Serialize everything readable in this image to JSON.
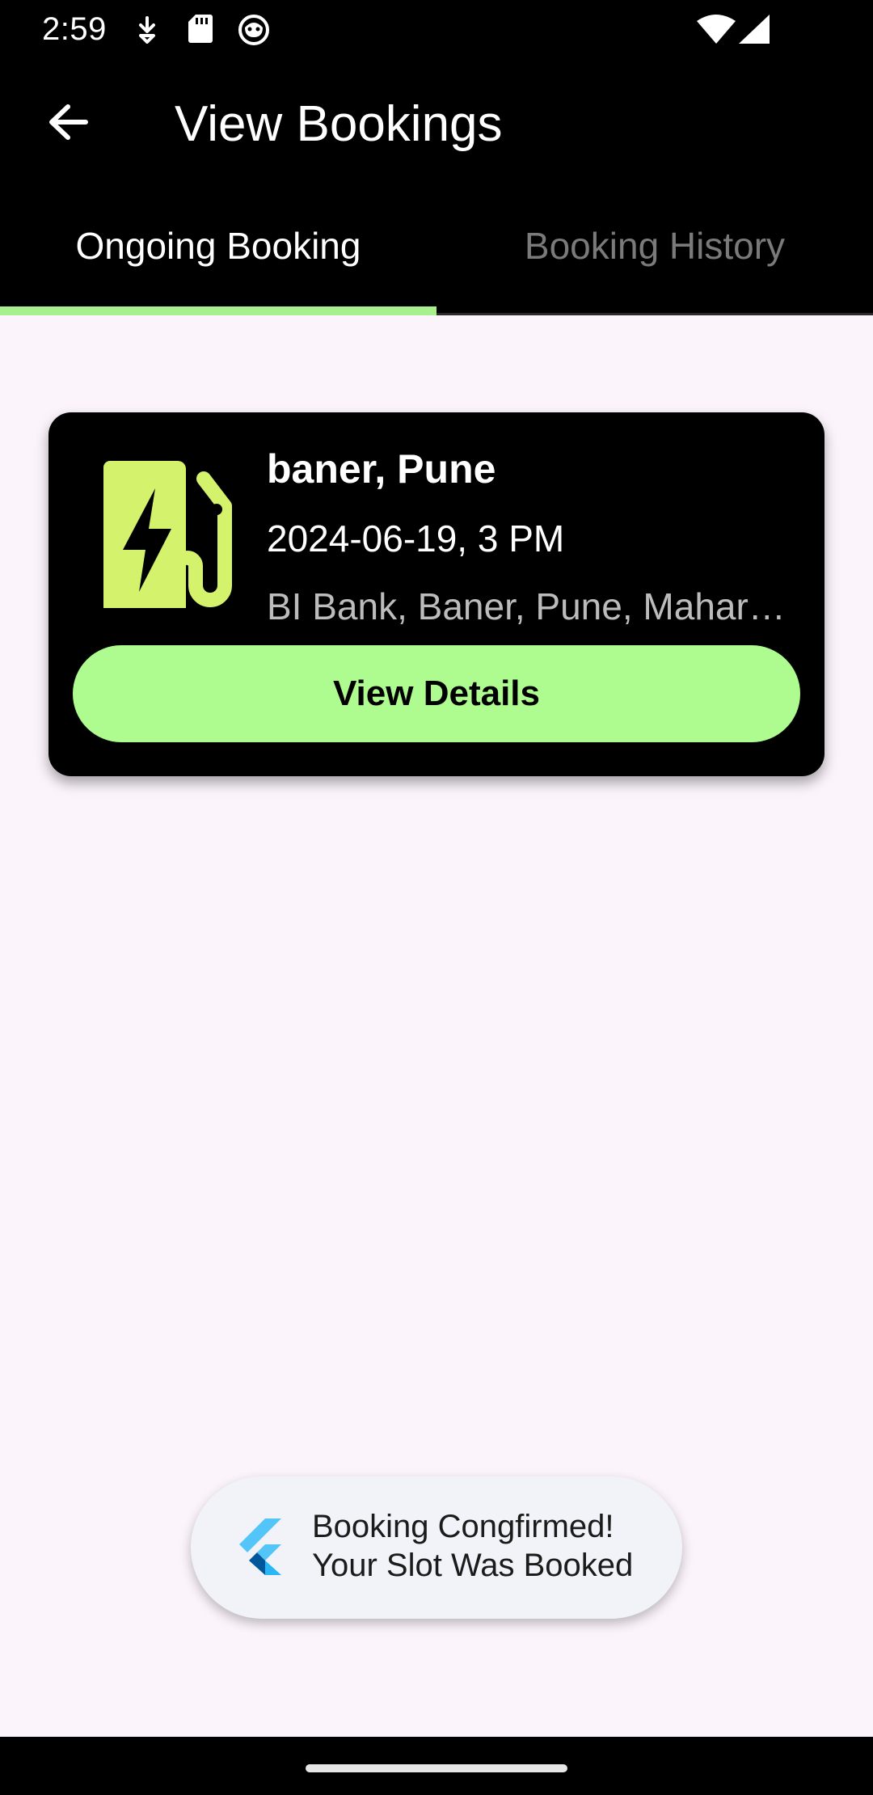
{
  "status_bar": {
    "time": "2:59",
    "icons": [
      "download-arrow-icon",
      "sd-card-icon",
      "cat-face-icon",
      "wifi-icon",
      "signal-icon"
    ]
  },
  "app_bar": {
    "title": "View Bookings",
    "back_icon": "arrow-left-icon"
  },
  "tabs": [
    {
      "label": "Ongoing Booking",
      "active": true
    },
    {
      "label": "Booking History",
      "active": false
    }
  ],
  "colors": {
    "accent": "#aefc8f",
    "icon_green": "#d4f26c",
    "background": "#fbf4fb",
    "bar": "#000000"
  },
  "booking": {
    "icon": "ev-charger-icon",
    "location": "baner, Pune",
    "datetime": "2024-06-19, 3 PM",
    "address": "BI Bank, Baner, Pune, Mahar…",
    "button_label": "View Details"
  },
  "toast": {
    "icon": "flutter-logo-icon",
    "line1": "Booking Congfirmed!",
    "line2": "Your Slot Was Booked"
  }
}
